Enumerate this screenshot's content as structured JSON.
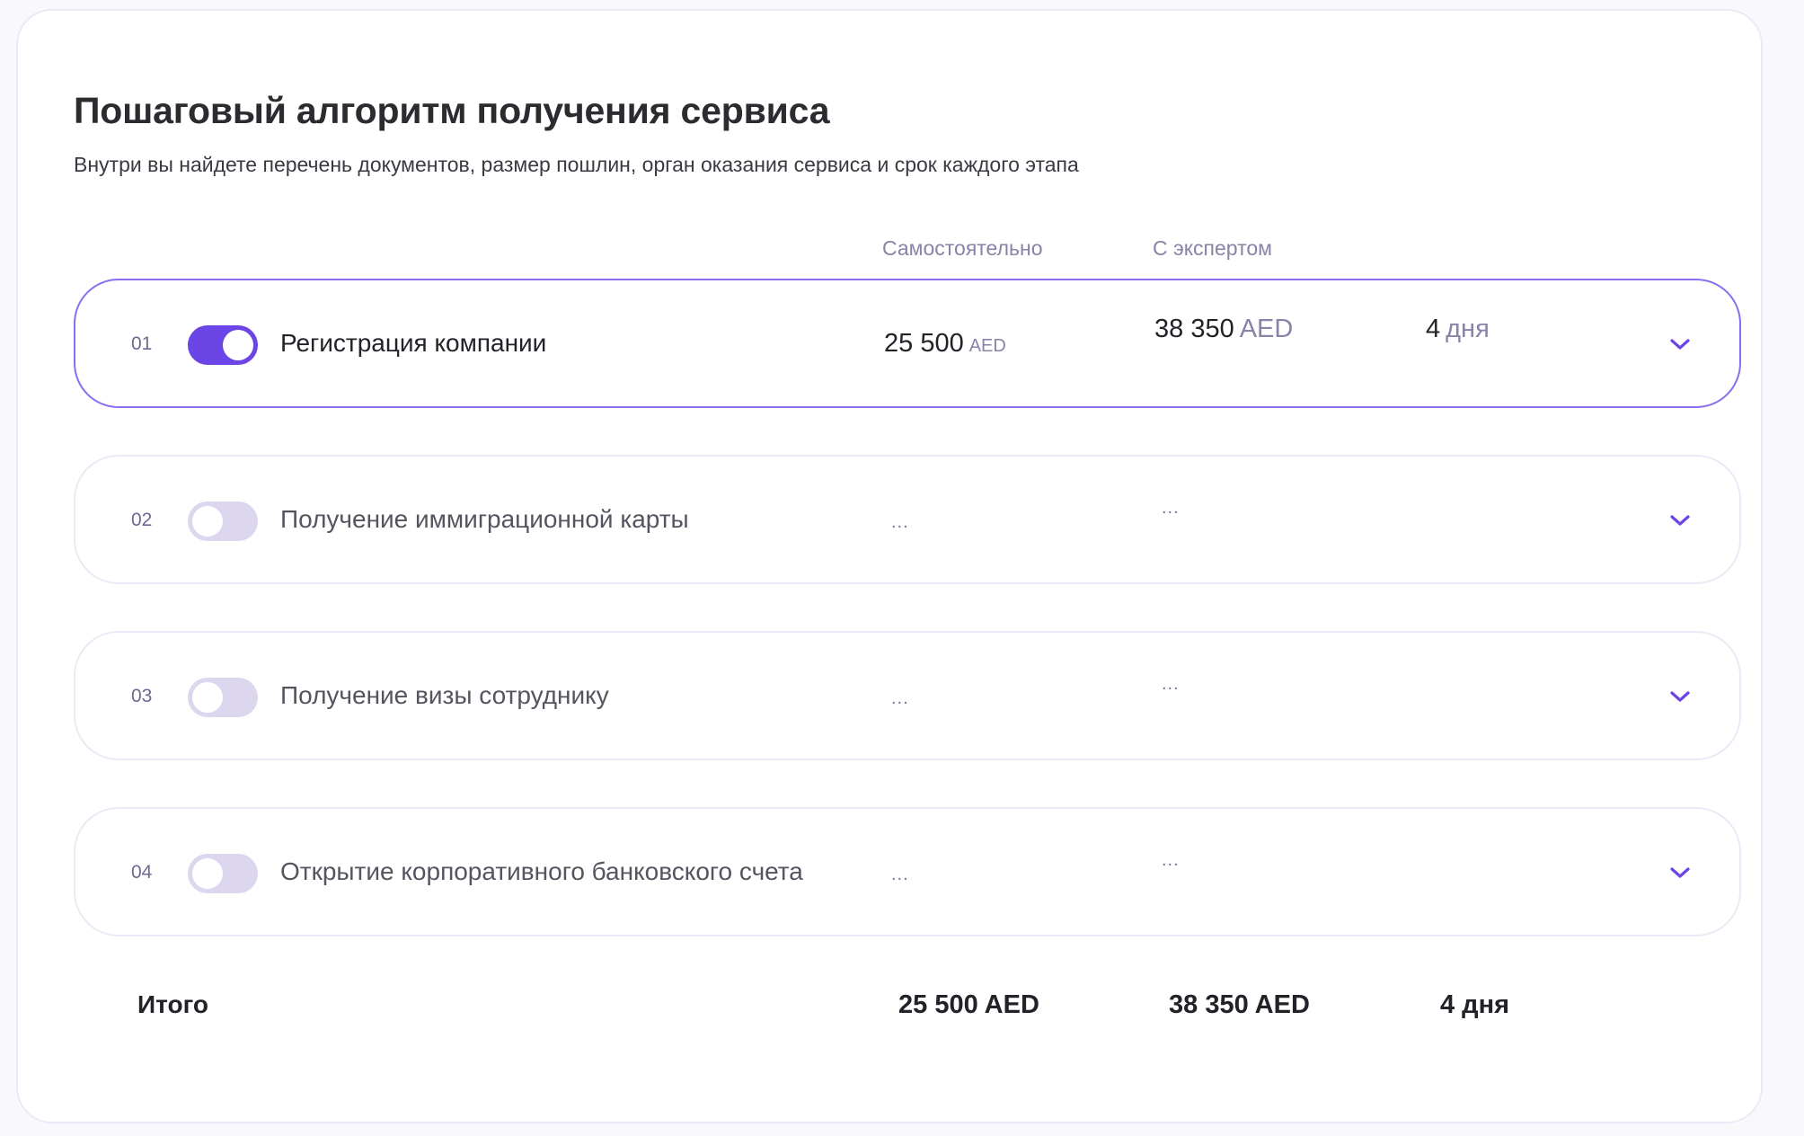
{
  "header": {
    "title": "Пошаговый алгоритм получения сервиса",
    "subtitle": "Внутри вы найдете перечень документов, размер пошлин, орган оказания сервиса и срок каждого этапа"
  },
  "columns": {
    "self": "Самостоятельно",
    "expert": "С экспертом"
  },
  "colors": {
    "accent": "#6c45e6",
    "toggle_off": "#dcd7ee",
    "muted": "#8a82a8"
  },
  "steps": [
    {
      "num": "01",
      "label": "Регистрация компании",
      "enabled": true,
      "self_amount": "25 500",
      "self_currency": "AED",
      "expert_amount": "38 350",
      "expert_currency": "AED",
      "days_num": "4",
      "days_unit": "дня",
      "icon": "chevron-down-icon"
    },
    {
      "num": "02",
      "label": "Получение иммиграционной карты",
      "enabled": false,
      "self_placeholder": "...",
      "expert_placeholder": "...",
      "icon": "chevron-down-icon"
    },
    {
      "num": "03",
      "label": "Получение визы сотруднику",
      "enabled": false,
      "self_placeholder": "...",
      "expert_placeholder": "...",
      "icon": "chevron-down-icon"
    },
    {
      "num": "04",
      "label": "Открытие корпоративного банковского счета",
      "enabled": false,
      "self_placeholder": "...",
      "expert_placeholder": "...",
      "icon": "chevron-down-icon"
    }
  ],
  "total": {
    "label": "Итого",
    "self": "25 500 AED",
    "expert": "38 350 AED",
    "days": "4 дня"
  }
}
